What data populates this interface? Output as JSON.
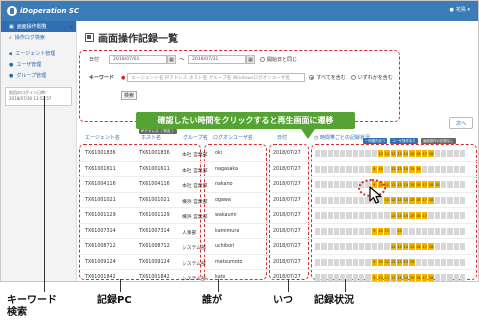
{
  "app": {
    "name": "iDoperation SC",
    "user_label": "花鳥 ▾"
  },
  "sidebar": {
    "collapse_icon": "«",
    "items": [
      {
        "label": "画面操作閲覧",
        "active": true
      },
      {
        "label": "操作ログ検索",
        "active": false
      },
      {
        "label": "エージェント管理",
        "active": false
      },
      {
        "label": "ユーザ管理",
        "active": false
      },
      {
        "label": "グループ管理",
        "active": false
      }
    ],
    "last_login_label": "前回のログイン日時：",
    "last_login_value": "2018/07/30 13:52:57"
  },
  "page": {
    "title": "画面操作記録一覧"
  },
  "search": {
    "date_label": "日付",
    "date_from": "2018/07/01",
    "date_to": "2018/07/31",
    "date_sep": "〜",
    "same_as_start_label": "開始日と同じ",
    "keyword_label": "キーワード",
    "keyword_placeholder": "エージェント名 IPアドレス ホスト名 グループ名 Windowsログオンユーザ名",
    "radio_all": "すべてを含む",
    "radio_any": "いずれかを含む",
    "search_button": "検索"
  },
  "callout": "確認したい時間をクリックすると再生画面に遷移",
  "next_button": "次へ",
  "table": {
    "headers": {
      "agent": "エージェント名",
      "host": "ホスト名",
      "group": "グループ名",
      "logon_user": "ログオンユーザ名",
      "date": "日付",
      "status": "時間帯ごとの記録状況"
    },
    "host_badge": "IPアドレス（ 別名 ）",
    "legend_operation": "一時間内あり",
    "legend_user": "ユーザ操作あり",
    "legend_none": "画面操作の記録なし",
    "rows": [
      {
        "agent": "TX61001836",
        "host": "TX61001836",
        "group": "本社 営業部",
        "user": "oki",
        "date": "2018/07/27",
        "active": [
          10,
          11,
          12,
          13,
          14,
          15,
          16,
          17,
          18
        ]
      },
      {
        "agent": "TX61001611",
        "host": "TX61001611",
        "group": "本社 営業部",
        "user": "nagasaka",
        "date": "2018/07/27",
        "active": [
          9,
          10,
          12,
          13,
          14,
          15,
          16
        ]
      },
      {
        "agent": "TX61004116",
        "host": "TX61004116",
        "group": "本社 営業部",
        "user": "nakano",
        "date": "2018/07/27",
        "active": [
          9,
          10,
          11,
          12,
          13,
          14,
          15,
          16,
          17,
          18,
          19
        ]
      },
      {
        "agent": "TX61001021",
        "host": "TX61001021",
        "group": "横浜 営業部",
        "user": "ogawa",
        "date": "2018/07/27",
        "active": [
          11,
          12,
          13,
          14,
          15,
          16,
          17,
          18
        ]
      },
      {
        "agent": "TX61001129",
        "host": "TX61001129",
        "group": "横浜 営業部",
        "user": "wakaumi",
        "date": "2018/07/27",
        "active": [
          12,
          13,
          14,
          15,
          16,
          17
        ]
      },
      {
        "agent": "TX61007314",
        "host": "TX61007314",
        "group": "人事部",
        "user": "kamimura",
        "date": "2018/07/27",
        "active": [
          9,
          10,
          11,
          13
        ]
      },
      {
        "agent": "TX61008712",
        "host": "TX61008712",
        "group": "システム部",
        "user": "uchibori",
        "date": "2018/07/27",
        "active": [
          12,
          13,
          14,
          15,
          16,
          17,
          18
        ]
      },
      {
        "agent": "TX61009124",
        "host": "TX61009124",
        "group": "システム部",
        "user": "matsumoto",
        "date": "2018/07/27",
        "active": [
          9,
          10,
          11,
          12,
          13,
          14,
          15
        ]
      },
      {
        "agent": "TX61001842",
        "host": "TX61001842",
        "group": "システム部",
        "user": "kato",
        "date": "2018/07/27",
        "active": [
          9,
          10,
          11,
          12,
          13,
          14,
          15,
          16,
          17,
          18
        ]
      }
    ]
  },
  "annotations": {
    "keyword": "キーワード\n検索",
    "pc": "記録PC",
    "who": "誰が",
    "when": "いつ",
    "status": "記録状況"
  }
}
